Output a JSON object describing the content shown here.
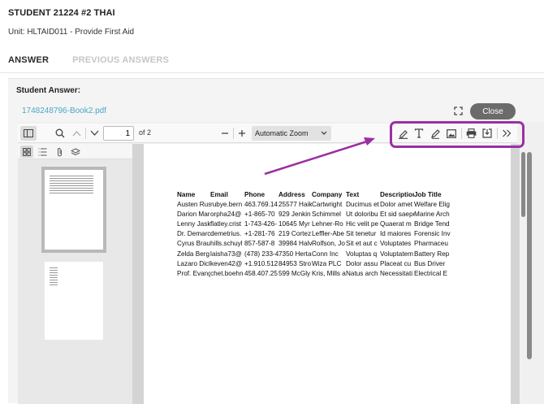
{
  "header": {
    "title": "STUDENT 21224 #2 THAI",
    "unit": "Unit: HLTAID011 - Provide First Aid"
  },
  "tabs": [
    {
      "label": "ANSWER",
      "active": true
    },
    {
      "label": "PREVIOUS ANSWERS",
      "active": false
    }
  ],
  "card": {
    "label": "Student Answer:"
  },
  "viewer": {
    "file_name": "1748248796-Book2.pdf",
    "close_label": "Close",
    "page_number": "1",
    "page_of": "of 2",
    "zoom": "Automatic Zoom"
  },
  "table": {
    "headers": [
      "Name",
      "Email",
      "Phone",
      "Address",
      "Company",
      "Text",
      "Description",
      "Job Title"
    ],
    "rows": [
      [
        "Austen Rus",
        "rubye.bern",
        "463.769.14",
        "25577 Haik",
        "Cartwright",
        "Ducimus et",
        "Dolor amet",
        "Welfare Elig"
      ],
      [
        "Darion Mar",
        "orpha24@",
        "+1-865-70",
        "929 Jenkin",
        "Schimmel",
        "Ut doloribu",
        "Et sid saepe",
        "Marine Arch"
      ],
      [
        "Lenny Jask",
        "flatley.crist",
        "1-743-426-",
        "10645 Myr",
        "Lehner-Ro",
        "Hic velit pe",
        "Quaerat m",
        "Bridge Tend"
      ],
      [
        "Dr. Demarc",
        "demetrius.",
        "+1-281-76",
        "219 Cortez",
        "Leffler-Abe",
        "Sit tenetur",
        "Id maiores",
        "Forensic Inv"
      ],
      [
        "Cyrus Brau",
        "hills.schuyl",
        "857-587-8",
        "39984 Halv",
        "Rolfson, Jo",
        "Sit et aut c",
        "Voluptates",
        "Pharmaceu"
      ],
      [
        "Zelda Berg",
        "laisha73@",
        "(478) 233-4",
        "7350 Herta",
        "Conn Inc",
        "Voluptas q",
        "Voluptatem",
        "Battery Rep"
      ],
      [
        "Lazaro Dicl",
        "keven42@",
        "+1.910.512",
        "84953 Stro",
        "Wiza PLC",
        "Dolor assu",
        "Placeat cu",
        "Bus Driver"
      ],
      [
        "Prof. Evang",
        "chet.boehn",
        "458.407.25",
        "599 McGly",
        "Kris, Mills a",
        "Natus arch",
        "Necessitati",
        "Electrical E"
      ]
    ]
  },
  "icons": {
    "highlight": "highlight-icon",
    "text": "text-icon",
    "draw": "draw-icon",
    "image": "image-icon",
    "print": "print-icon",
    "save": "save-icon",
    "more": "more-tools-icon"
  },
  "colors": {
    "annotation": "#9b2fa3",
    "link": "#4aa8c9",
    "close_button": "#6b6b6b"
  }
}
